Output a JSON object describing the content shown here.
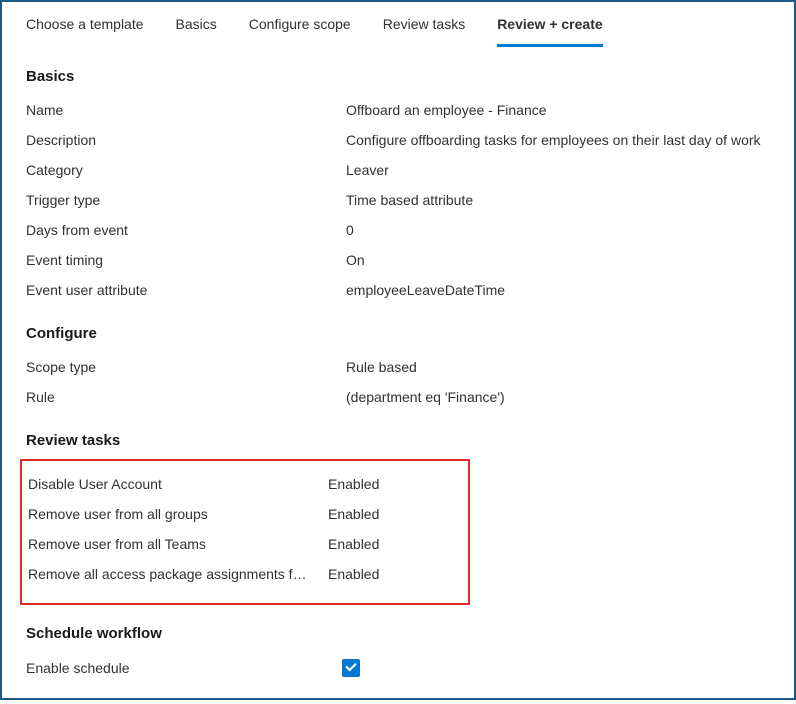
{
  "tabs": {
    "choose_template": "Choose a template",
    "basics": "Basics",
    "configure_scope": "Configure scope",
    "review_tasks": "Review tasks",
    "review_create": "Review + create"
  },
  "sections": {
    "basics": {
      "title": "Basics",
      "rows": {
        "name": {
          "label": "Name",
          "value": "Offboard an employee - Finance"
        },
        "description": {
          "label": "Description",
          "value": "Configure offboarding tasks for employees on their last day of work"
        },
        "category": {
          "label": "Category",
          "value": "Leaver"
        },
        "trigger_type": {
          "label": "Trigger type",
          "value": "Time based attribute"
        },
        "days_from_event": {
          "label": "Days from event",
          "value": "0"
        },
        "event_timing": {
          "label": "Event timing",
          "value": "On"
        },
        "event_user_attribute": {
          "label": "Event user attribute",
          "value": "employeeLeaveDateTime"
        }
      }
    },
    "configure": {
      "title": "Configure",
      "rows": {
        "scope_type": {
          "label": "Scope type",
          "value": "Rule based"
        },
        "rule": {
          "label": "Rule",
          "value": " (department eq 'Finance')"
        }
      }
    },
    "review_tasks": {
      "title": "Review tasks",
      "items": [
        {
          "label": "Disable User Account",
          "value": "Enabled"
        },
        {
          "label": "Remove user from all groups",
          "value": "Enabled"
        },
        {
          "label": "Remove user from all Teams",
          "value": "Enabled"
        },
        {
          "label": "Remove all access package assignments f…",
          "value": "Enabled"
        }
      ]
    },
    "schedule_workflow": {
      "title": "Schedule workflow",
      "enable_schedule": {
        "label": "Enable schedule",
        "checked": true
      }
    }
  }
}
